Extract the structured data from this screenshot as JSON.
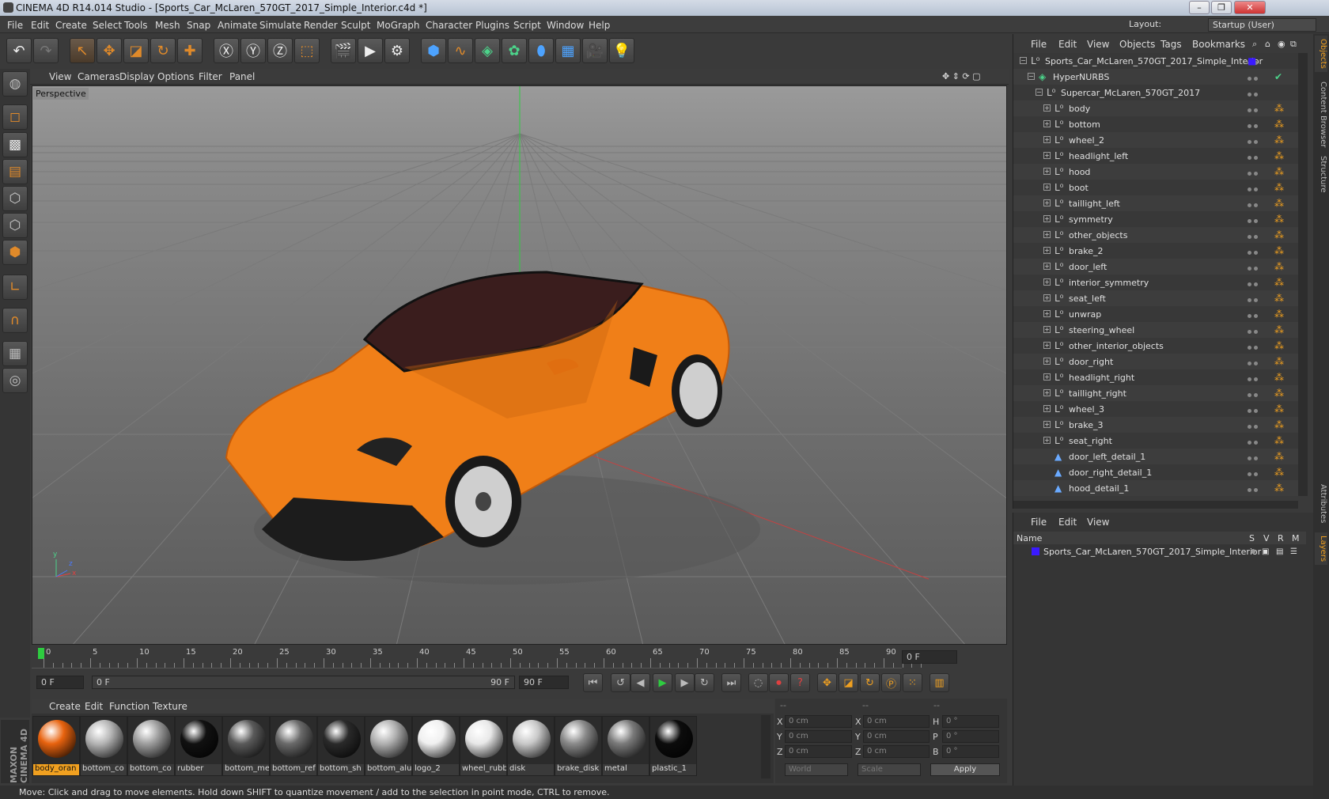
{
  "window": {
    "title": "CINEMA 4D R14.014 Studio - [Sports_Car_McLaren_570GT_2017_Simple_Interior.c4d *]",
    "minimize": "–",
    "restore": "❐",
    "close": "✕"
  },
  "menu": [
    "File",
    "Edit",
    "Create",
    "Select",
    "Tools",
    "Mesh",
    "Snap",
    "Animate",
    "Simulate",
    "Render",
    "Sculpt",
    "MoGraph",
    "Character",
    "Plugins",
    "Script",
    "Window",
    "Help"
  ],
  "layout": {
    "label": "Layout:",
    "value": "Startup (User)"
  },
  "toolbar_icons": [
    "undo-icon",
    "redo-icon",
    "live-selection-icon",
    "move-icon",
    "scale-icon",
    "rotate-icon",
    "add-icon",
    "x-axis-icon",
    "y-axis-icon",
    "z-axis-icon",
    "coordinate-system-icon",
    "render-view-icon",
    "render-picture-viewer-icon",
    "render-settings-icon",
    "cube-icon",
    "spline-icon",
    "nurbs-icon",
    "mograph-icon",
    "deformer-icon",
    "floor-icon",
    "camera-icon",
    "light-icon"
  ],
  "viewport": {
    "menu": [
      "View",
      "Cameras",
      "Display",
      "Options",
      "Filter",
      "Panel"
    ],
    "label": "Perspective",
    "axis_x": "x",
    "axis_y": "y",
    "axis_z": "z"
  },
  "timeline": {
    "ticks": [
      "0",
      "5",
      "10",
      "15",
      "20",
      "25",
      "30",
      "35",
      "40",
      "45",
      "50",
      "55",
      "60",
      "65",
      "70",
      "75",
      "80",
      "85",
      "90"
    ],
    "current_frame": "0 F",
    "start": "0 F",
    "range_start": "0 F",
    "range_end": "90 F",
    "end": "90 F"
  },
  "materials_menu": [
    "Create",
    "Edit",
    "Function",
    "Texture"
  ],
  "materials": [
    {
      "name": "body_oran",
      "color": "#e8630f"
    },
    {
      "name": "bottom_co",
      "color": "#b5b5b5"
    },
    {
      "name": "bottom_co",
      "color": "#9e9e9e"
    },
    {
      "name": "rubber",
      "color": "#111111"
    },
    {
      "name": "bottom_me",
      "color": "#5a5a5a"
    },
    {
      "name": "bottom_ref",
      "color": "#6a6a6a"
    },
    {
      "name": "bottom_sh",
      "color": "#2a2a2a"
    },
    {
      "name": "bottom_alu",
      "color": "#b0b0b0"
    },
    {
      "name": "logo_2",
      "color": "#f0f0f0"
    },
    {
      "name": "wheel_rubb",
      "color": "#e8e8e8"
    },
    {
      "name": "disk",
      "color": "#c8c8c8"
    },
    {
      "name": "brake_disk",
      "color": "#8a8a8a"
    },
    {
      "name": "metal",
      "color": "#7a7a7a"
    },
    {
      "name": "plastic_1",
      "color": "#0c0c0c"
    }
  ],
  "coords": {
    "header": [
      "--",
      "--",
      "--"
    ],
    "rows": [
      {
        "a": "X",
        "av": "0 cm",
        "b": "X",
        "bv": "0 cm",
        "c": "H",
        "cv": "0 °"
      },
      {
        "a": "Y",
        "av": "0 cm",
        "b": "Y",
        "bv": "0 cm",
        "c": "P",
        "cv": "0 °"
      },
      {
        "a": "Z",
        "av": "0 cm",
        "b": "Z",
        "bv": "0 cm",
        "c": "B",
        "cv": "0 °"
      }
    ],
    "mode": "World",
    "transform": "Scale",
    "apply": "Apply"
  },
  "status": "Move: Click and drag to move elements. Hold down SHIFT to quantize movement / add to the selection in point mode, CTRL to remove.",
  "objects": {
    "menu": [
      "File",
      "Edit",
      "View",
      "Objects",
      "Tags",
      "Bookmarks"
    ],
    "items": [
      {
        "name": "Sports_Car_McLaren_570GT_2017_Simple_Interior",
        "depth": 0
      },
      {
        "name": "HyperNURBS",
        "depth": 1
      },
      {
        "name": "Supercar_McLaren_570GT_2017",
        "depth": 2
      },
      {
        "name": "body",
        "depth": 3
      },
      {
        "name": "bottom",
        "depth": 3
      },
      {
        "name": "wheel_2",
        "depth": 3
      },
      {
        "name": "headlight_left",
        "depth": 3
      },
      {
        "name": "hood",
        "depth": 3
      },
      {
        "name": "boot",
        "depth": 3
      },
      {
        "name": "taillight_left",
        "depth": 3
      },
      {
        "name": "symmetry",
        "depth": 3
      },
      {
        "name": "other_objects",
        "depth": 3
      },
      {
        "name": "brake_2",
        "depth": 3
      },
      {
        "name": "door_left",
        "depth": 3
      },
      {
        "name": "interior_symmetry",
        "depth": 3
      },
      {
        "name": "seat_left",
        "depth": 3
      },
      {
        "name": "unwrap",
        "depth": 3
      },
      {
        "name": "steering_wheel",
        "depth": 3
      },
      {
        "name": "other_interior_objects",
        "depth": 3
      },
      {
        "name": "door_right",
        "depth": 3
      },
      {
        "name": "headlight_right",
        "depth": 3
      },
      {
        "name": "taillight_right",
        "depth": 3
      },
      {
        "name": "wheel_3",
        "depth": 3
      },
      {
        "name": "brake_3",
        "depth": 3
      },
      {
        "name": "seat_right",
        "depth": 3
      },
      {
        "name": "door_left_detail_1",
        "depth": 3
      },
      {
        "name": "door_right_detail_1",
        "depth": 3
      },
      {
        "name": "hood_detail_1",
        "depth": 3
      }
    ]
  },
  "layers": {
    "menu": [
      "File",
      "Edit",
      "View"
    ],
    "header": {
      "name": "Name",
      "s": "S",
      "v": "V",
      "r": "R",
      "m": "M"
    },
    "row": "Sports_Car_McLaren_570GT_2017_Simple_Interior",
    "row_color": "#3a1aff"
  },
  "side_tabs": [
    "Objects",
    "Content Browser",
    "Structure",
    "Attributes",
    "Layers"
  ],
  "brand": "MAXON CINEMA 4D"
}
